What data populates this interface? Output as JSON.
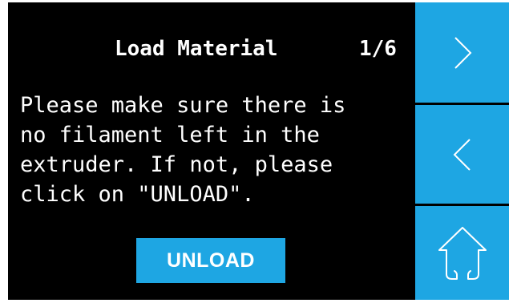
{
  "screen": {
    "title": "Load Material",
    "page_indicator": "1/6",
    "message_lines": [
      "Please make sure there is",
      "no filament left in the",
      "extruder. If not, please",
      "click on \"UNLOAD\"."
    ],
    "unload_label": "UNLOAD"
  },
  "sidebar": {
    "buttons": [
      {
        "icon": "chevron-right-icon"
      },
      {
        "icon": "chevron-left-icon"
      },
      {
        "icon": "home-icon"
      }
    ]
  },
  "colors": {
    "accent": "#1ea6e3",
    "background": "#000000",
    "text": "#ffffff"
  }
}
